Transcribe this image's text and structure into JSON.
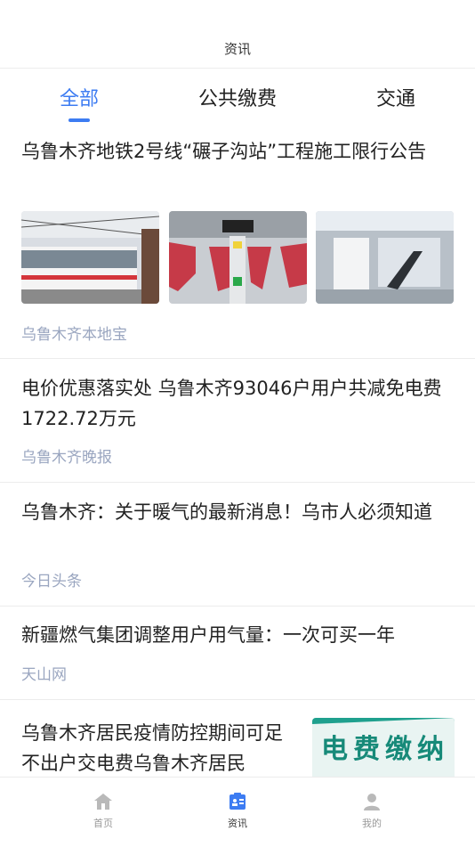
{
  "header": {
    "title": "资讯"
  },
  "tabs": [
    {
      "label": "全部"
    },
    {
      "label": "公共缴费"
    },
    {
      "label": "交通"
    }
  ],
  "articles": [
    {
      "title": "乌鲁木齐地铁2号线“碾子沟站”工程施工限行公告",
      "source": "乌鲁木齐本地宝"
    },
    {
      "title": "电价优惠落实处 乌鲁木齐93046户用户共减免电费1722.72万元",
      "source": "乌鲁木齐晚报"
    },
    {
      "title": "乌鲁木齐：关于暖气的最新消息！乌市人必须知道",
      "source": "今日头条"
    },
    {
      "title": "新疆燃气集团调整用户用气量：一次可买一年",
      "source": "天山网"
    },
    {
      "title": "乌鲁木齐居民疫情防控期间可足不出户交电费乌鲁木齐居民",
      "image_text": "电费缴纳"
    }
  ],
  "bottom_nav": [
    {
      "label": "首页",
      "icon": "home-icon"
    },
    {
      "label": "资讯",
      "icon": "news-icon"
    },
    {
      "label": "我的",
      "icon": "profile-icon"
    }
  ],
  "colors": {
    "accent": "#3d7cf2",
    "source": "#9aa6c0",
    "divider": "#ececec"
  }
}
